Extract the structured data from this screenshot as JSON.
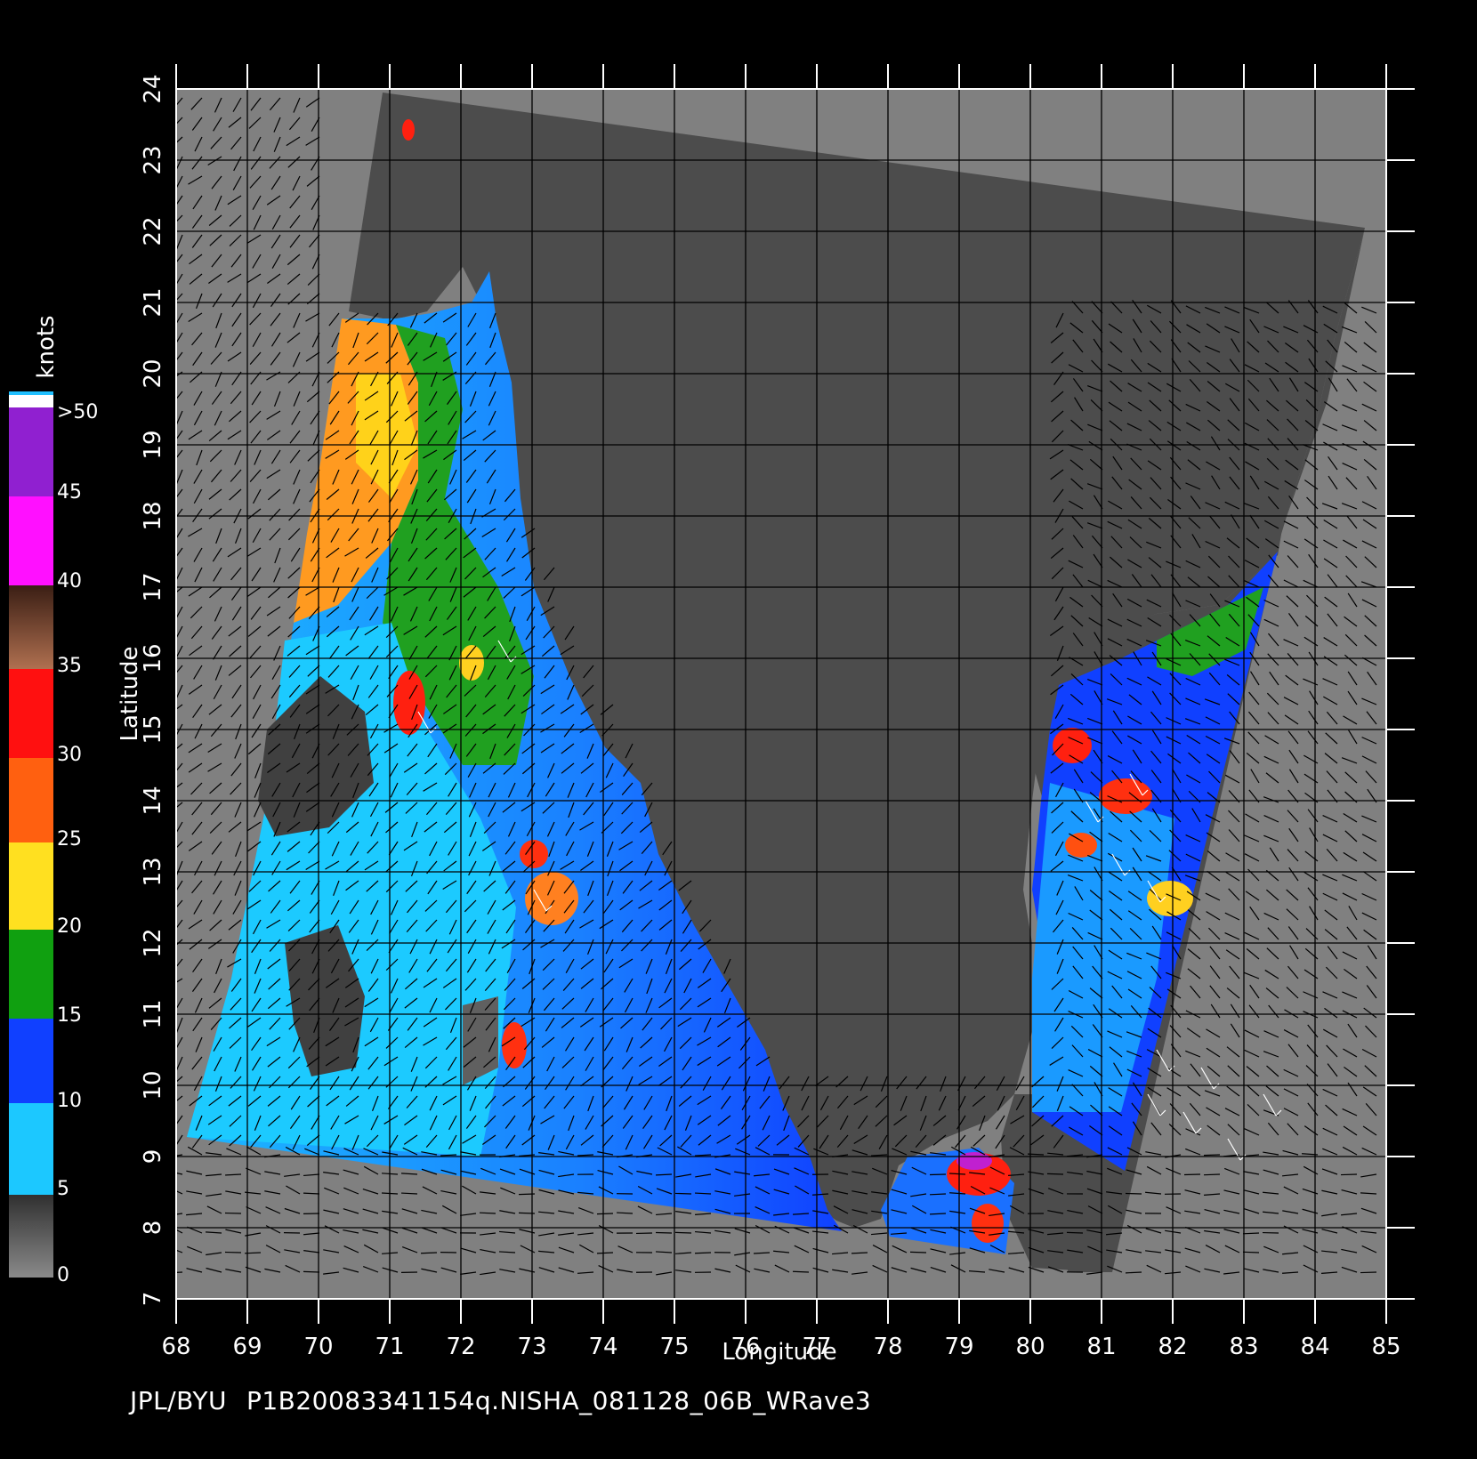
{
  "credit": "JPL/BYU",
  "file_id": "P1B20083341154q.NISHA_081128_06B_WRave3",
  "x_axis": {
    "label": "Longitude",
    "ticks": [
      "68",
      "69",
      "70",
      "71",
      "72",
      "73",
      "74",
      "75",
      "76",
      "77",
      "78",
      "79",
      "80",
      "81",
      "82",
      "83",
      "84",
      "85"
    ]
  },
  "y_axis": {
    "label": "Latitude",
    "ticks": [
      "7",
      "8",
      "9",
      "10",
      "11",
      "12",
      "13",
      "14",
      "15",
      "16",
      "17",
      "18",
      "19",
      "20",
      "21",
      "22",
      "23",
      "24"
    ]
  },
  "colorbar": {
    "title": "knots",
    "labels": [
      "0",
      "5",
      "10",
      "15",
      "20",
      "25",
      "30",
      "35",
      "40",
      "45",
      ">50"
    ],
    "colors": {
      "0_5": "#5a5a5a",
      "5_10": "#1ab0ff",
      "10_15": "#1040ff",
      "15_20": "#10a010",
      "20_25": "#ffe020",
      "25_30": "#ff6010",
      "30_35": "#ff1010",
      "35_40": "#7a4030",
      "40_45": "#ff10ff",
      "45_50": "#9020d0"
    }
  },
  "colors": {
    "background": "#000000",
    "outside_swath": "#808080",
    "land": "#4c4c4c",
    "grid": "#000000",
    "wind_barb": "#000000",
    "rain_flag": "#ffffff"
  }
}
